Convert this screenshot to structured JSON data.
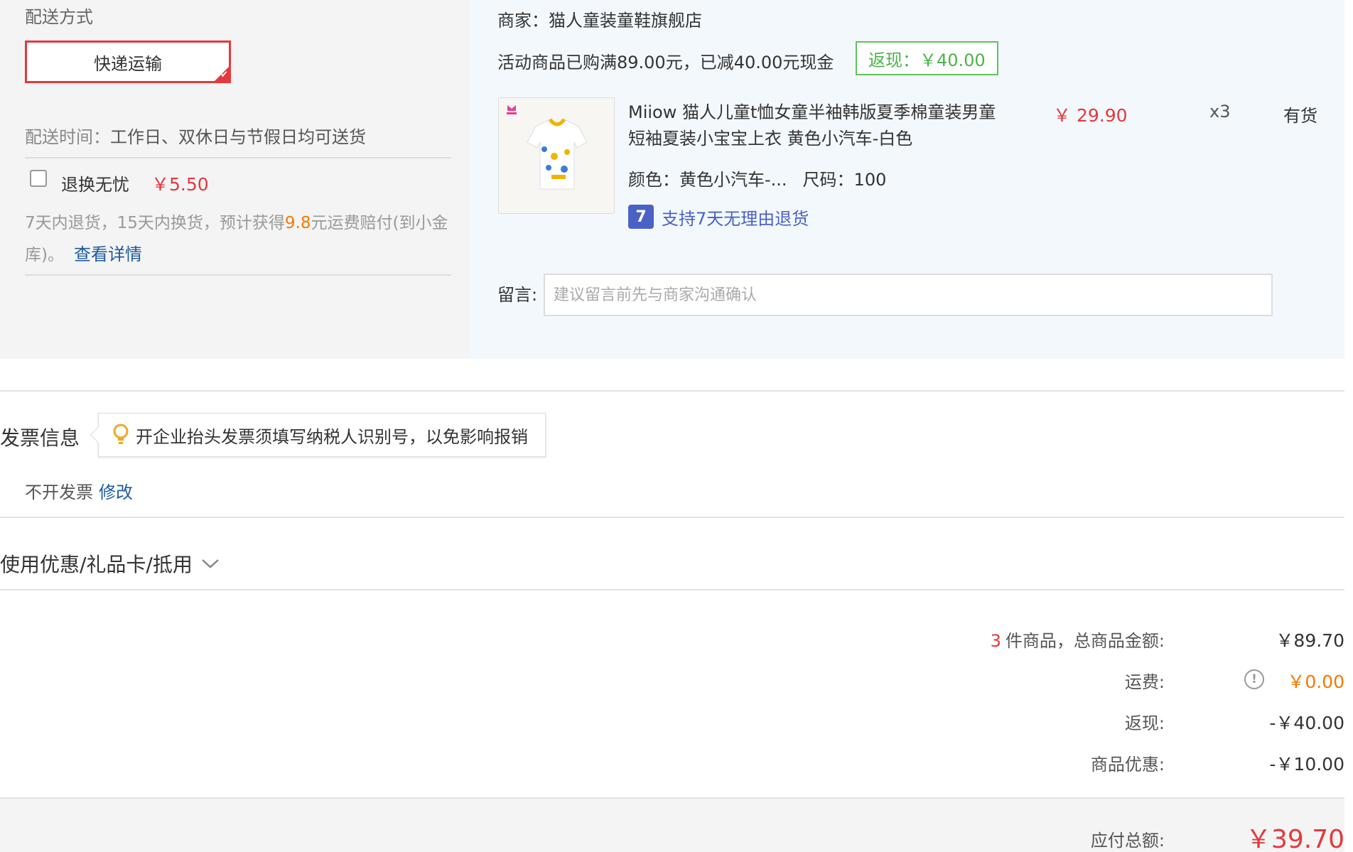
{
  "shipping": {
    "title": "配送方式",
    "method_label": "快递运输",
    "time_label": "配送时间：",
    "time_value": "工作日、双休日与节假日均可送货",
    "insurance": {
      "label": "退换无忧",
      "price": "￥5.50",
      "desc_prefix": "7天内退货，15天内换货，预计获得",
      "desc_highlight": "9.8",
      "desc_suffix": "元运费赔付(到小金库)。",
      "detail_link": "查看详情"
    }
  },
  "merchant": {
    "line": "商家：猫人童装童鞋旗舰店",
    "promo_text": "活动商品已购满89.00元，已减40.00元现金",
    "cashback_badge": "返现：￥40.00",
    "product": {
      "title": "Miiow 猫人儿童t恤女童半袖韩版夏季棉童装男童短袖夏装小宝宝上衣 黄色小汽车-白色",
      "price": "￥ 29.90",
      "quantity": "x3",
      "stock": "有货",
      "color_attr": "颜色：黄色小汽车-...",
      "size_attr": "尺码：100",
      "return_badge": "7",
      "return_policy": "支持7天无理由退货"
    },
    "message": {
      "label": "留言:",
      "placeholder": "建议留言前先与商家沟通确认"
    }
  },
  "invoice": {
    "title": "发票信息",
    "tip": "开企业抬头发票须填写纳税人识别号，以免影响报销",
    "status": "不开发票",
    "edit_link": "修改"
  },
  "coupons": {
    "label": "使用优惠/礼品卡/抵用"
  },
  "summary": {
    "item_count": "3",
    "goods_total_label": "件商品，总商品金额:",
    "goods_total": "￥89.70",
    "shipping_label": "运费:",
    "shipping_value": "￥0.00",
    "cashback_label": "返现:",
    "cashback_value": "-￥40.00",
    "discount_label": "商品优惠:",
    "discount_value": "-￥10.00",
    "payable_label": "应付总额:",
    "payable_value": "￥39.70"
  },
  "colors": {
    "accent_red": "#e4393c",
    "link_blue": "#1e5aa0",
    "cashback_green": "#4cb34a",
    "highlight_orange": "#f57a00"
  }
}
